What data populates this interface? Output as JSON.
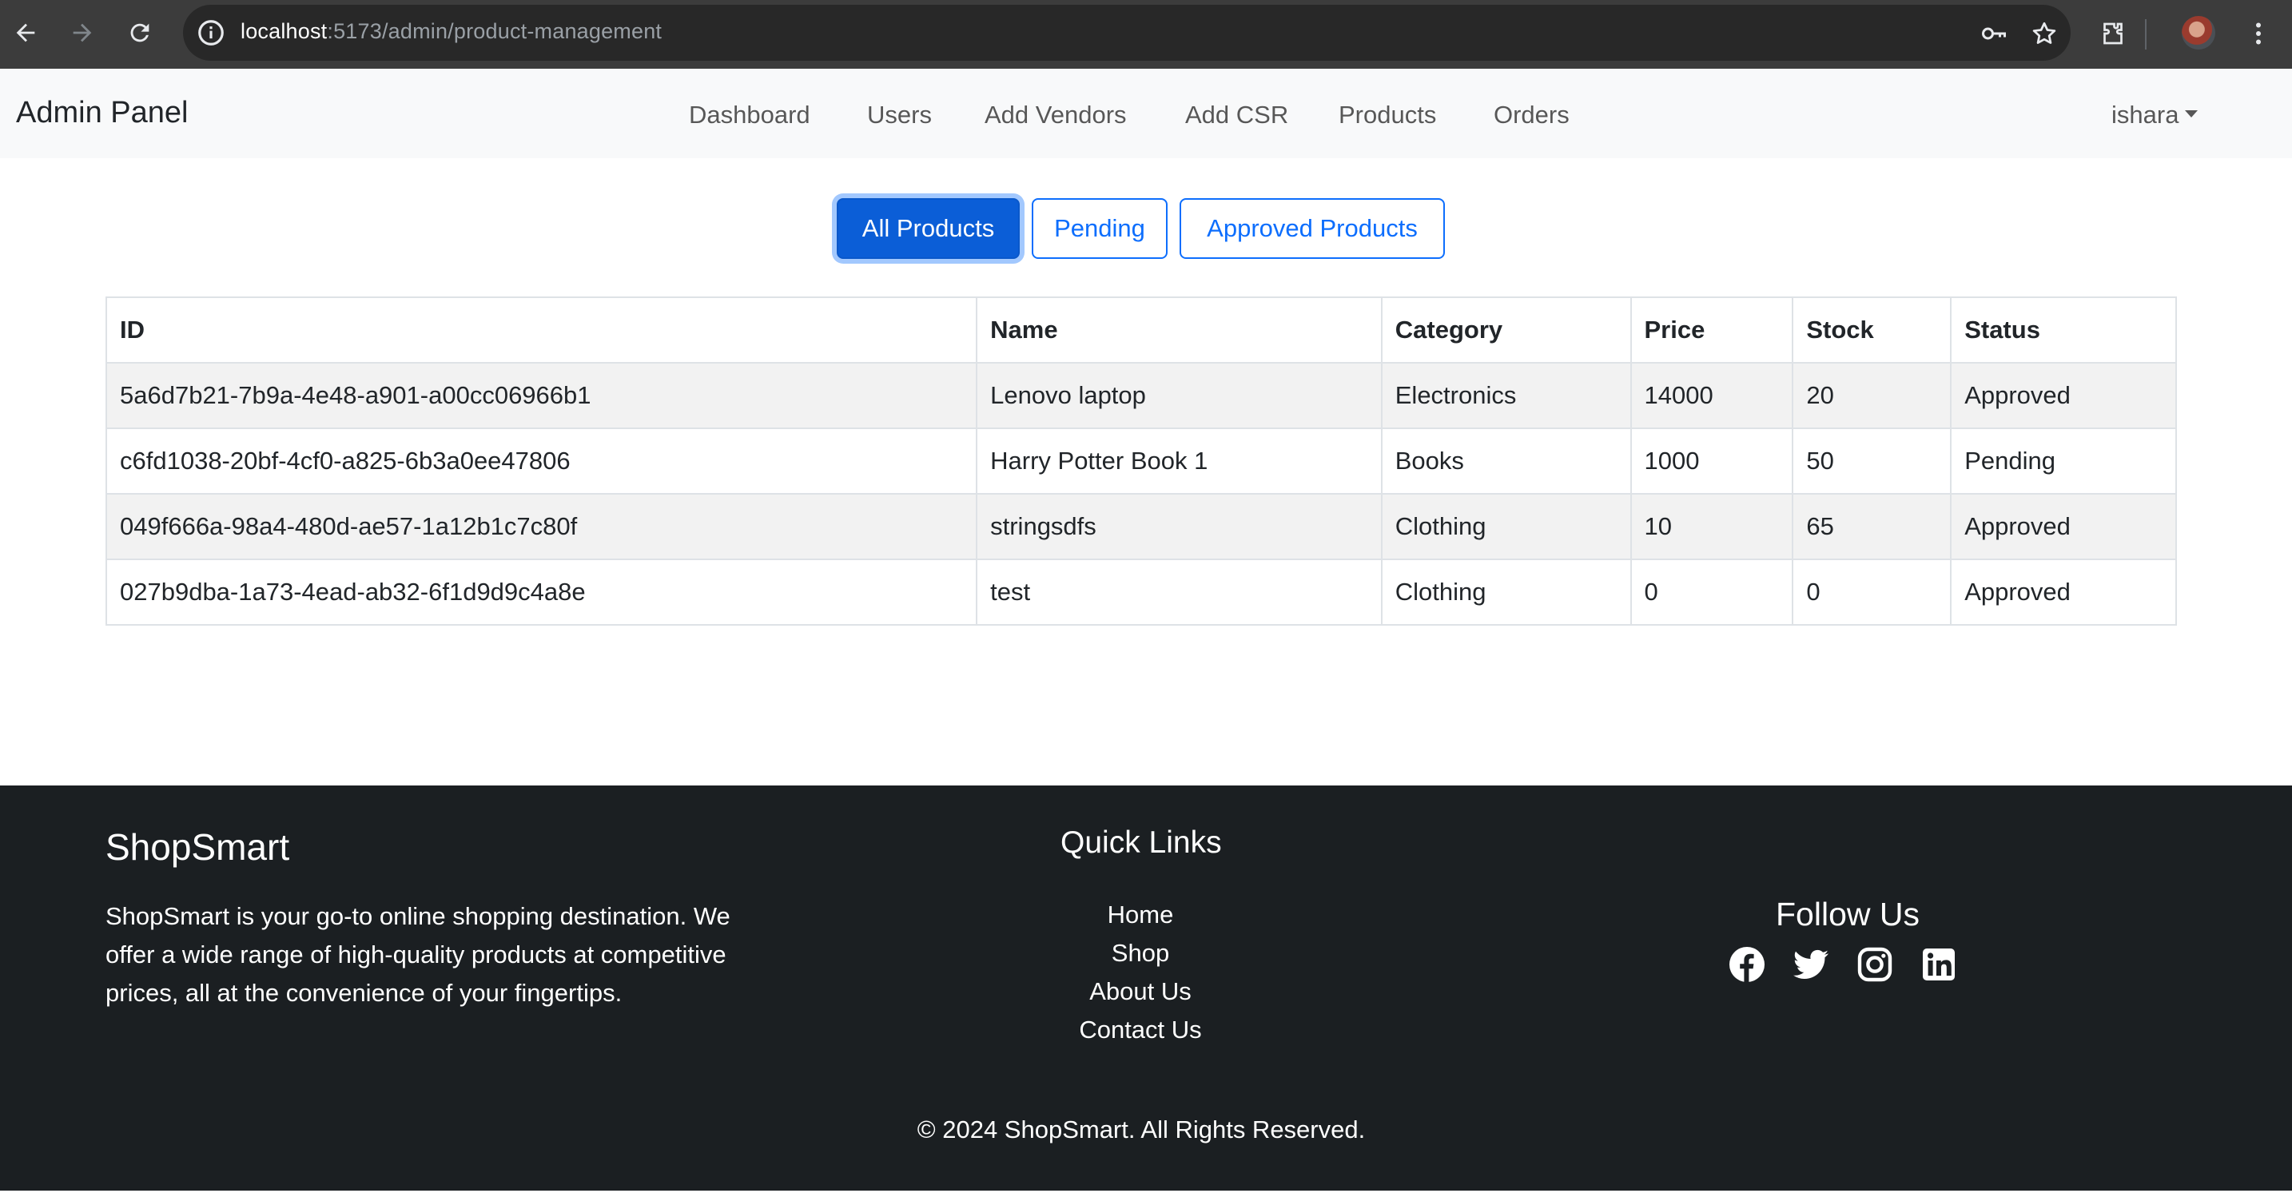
{
  "browser": {
    "url_host": "localhost",
    "url_path": ":5173/admin/product-management"
  },
  "navbar": {
    "brand": "Admin Panel",
    "links": [
      "Dashboard",
      "Users",
      "Add Vendors",
      "Add CSR",
      "Products",
      "Orders"
    ],
    "user": "ishara"
  },
  "tabs": {
    "all": "All Products",
    "pending": "Pending",
    "approved": "Approved Products",
    "active": "All Products"
  },
  "table": {
    "headers": [
      "ID",
      "Name",
      "Category",
      "Price",
      "Stock",
      "Status"
    ],
    "rows": [
      [
        "5a6d7b21-7b9a-4e48-a901-a00cc06966b1",
        "Lenovo laptop",
        "Electronics",
        "14000",
        "20",
        "Approved"
      ],
      [
        "c6fd1038-20bf-4cf0-a825-6b3a0ee47806",
        "Harry Potter Book 1",
        "Books",
        "1000",
        "50",
        "Pending"
      ],
      [
        "049f666a-98a4-480d-ae57-1a12b1c7c80f",
        "stringsdfs",
        "Clothing",
        "10",
        "65",
        "Approved"
      ],
      [
        "027b9dba-1a73-4ead-ab32-6f1d9d9c4a8e",
        "test",
        "Clothing",
        "0",
        "0",
        "Approved"
      ]
    ]
  },
  "footer": {
    "brand": "ShopSmart",
    "description": "ShopSmart is your go-to online shopping destination. We offer a wide range of high-quality products at competitive prices, all at the convenience of your fingertips.",
    "quick_links_title": "Quick Links",
    "quick_links": [
      "Home",
      "Shop",
      "About Us",
      "Contact Us"
    ],
    "follow_title": "Follow Us",
    "social_icons": [
      "facebook-icon",
      "twitter-icon",
      "instagram-icon",
      "linkedin-icon"
    ],
    "copyright": "© 2024 ShopSmart. All Rights Reserved."
  },
  "colors": {
    "primary": "#0d6efd",
    "footer_bg": "#1b1f22",
    "navbar_bg": "#f8f9fa"
  }
}
